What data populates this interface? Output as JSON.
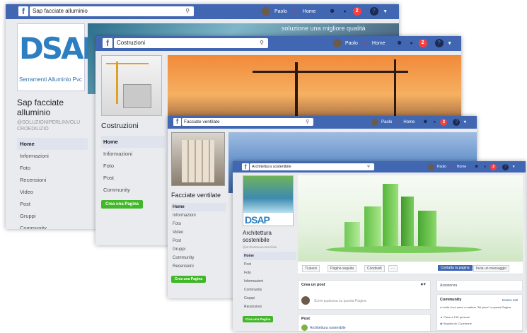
{
  "windows": [
    {
      "search_value": "Sap facciate alluminio",
      "nav_user": "Paolo",
      "nav_home": "Home",
      "notif_count": "2",
      "logo_text": "Serramenti Alluminio Pvc",
      "logo_big": "DSAP",
      "page_name": "Sap facciate alluminio",
      "handle": "@SOLUZIONIPERLINVOLUCROEDILIZIO",
      "cover_text": "soluzione una migliore qualità",
      "nav_items": [
        "Home",
        "Informazioni",
        "Foto",
        "Recensioni",
        "Video",
        "Post",
        "Gruppi",
        "Community"
      ]
    },
    {
      "search_value": "Costruzioni",
      "nav_user": "Paolo",
      "nav_home": "Home",
      "notif_count": "2",
      "page_name": "Costruzioni",
      "nav_items": [
        "Home",
        "Informazioni",
        "Foto",
        "Post",
        "Community"
      ],
      "cta": "Crea una Pagina"
    },
    {
      "search_value": "Facciate ventilate",
      "nav_user": "Paolo",
      "nav_home": "Home",
      "notif_count": "2",
      "page_name": "Facciate ventilate",
      "nav_items": [
        "Home",
        "Informazioni",
        "Foto",
        "Video",
        "Post",
        "Gruppi",
        "Community",
        "Recensioni"
      ],
      "cta": "Crea una Pagina"
    },
    {
      "search_value": "Architettura sostenibile",
      "nav_user": "Paolo",
      "nav_home": "Home",
      "notif_count": "2",
      "page_name": "Architettura sostenibile",
      "handle": "@architetturasostenibile",
      "nav_items": [
        "Home",
        "Post",
        "Foto",
        "Informazioni",
        "Community",
        "Gruppi",
        "Recensioni"
      ],
      "cta": "Crea una Pagina",
      "actions": {
        "like": "Ti piace",
        "follow": "Pagina seguita",
        "share": "Condividi",
        "more": "···",
        "contact": "Contatta la pagina",
        "send_message": "Invia un messaggio"
      },
      "create_post": "Crea un post",
      "post_placeholder": "Scrivi qualcosa su questa Pagina",
      "posts_header": "Post",
      "post_author": "Architettura sostenibile",
      "right": {
        "about": "Assistenza",
        "community_title": "Community",
        "see_all": "Mostra tutti",
        "lines": [
          "Invita i tuoi amici a mettere \"Mi piace\" a questa Pagina",
          "Piace a 13K persone",
          "Seguito da 13 persone"
        ]
      }
    }
  ],
  "colors": {
    "fb_blue": "#4267b2",
    "green": "#42b72a",
    "bg": "#e9ebee"
  }
}
